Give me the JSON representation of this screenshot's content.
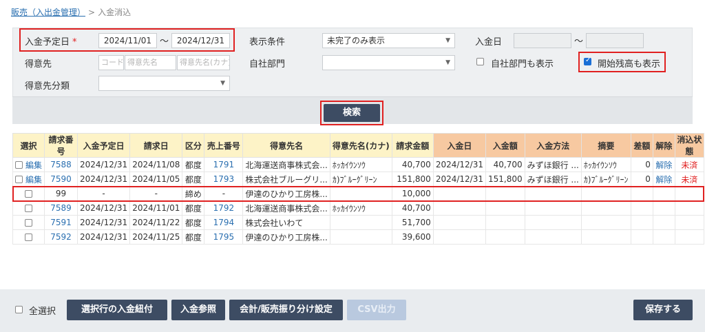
{
  "breadcrumb": {
    "parent": "販売（入出金管理）",
    "separator": ">",
    "current": "入金消込"
  },
  "search": {
    "due_date_label": "入金予定日",
    "required_mark": "*",
    "due_from": "2024/11/01",
    "due_to": "2024/12/31",
    "tilde": "〜",
    "display_cond_label": "表示条件",
    "display_cond_value": "未完了のみ表示",
    "payment_date_label": "入金日",
    "payment_from": "",
    "payment_to": "",
    "customer_label": "得意先",
    "customer_code_ph": "コード",
    "customer_name_ph": "得意先名",
    "customer_kana_ph": "得意先名(カナ)",
    "dept_label": "自社部門",
    "dept_value": "",
    "show_dept_label": "自社部門も表示",
    "show_opening_label": "開始残高も表示",
    "customer_class_label": "得意先分類",
    "customer_class_value": "",
    "search_button": "検索"
  },
  "table": {
    "headers": [
      "選択",
      "請求番号",
      "入金予定日",
      "請求日",
      "区分",
      "売上番号",
      "得意先名",
      "得意先名(カナ)",
      "請求金額",
      "入金日",
      "入金額",
      "入金方法",
      "摘要",
      "差額",
      "解除",
      "消込状態"
    ],
    "rows": [
      {
        "edit": "編集",
        "inv_no": "7588",
        "due": "2024/12/31",
        "inv_date": "2024/11/08",
        "kubun": "都度",
        "sales_no": "1791",
        "name": "北海運送商事株式会...",
        "kana": "ﾎｯｶｲｳﾝｿｳ",
        "amount": "40,700",
        "pay_date": "2024/12/31",
        "pay_amt": "40,700",
        "method": "みずほ銀行 ...",
        "memo": "ﾎｯｶｲｳﾝｿｳ",
        "diff": "0",
        "cancel": "解除",
        "status": "未済"
      },
      {
        "edit": "編集",
        "inv_no": "7590",
        "due": "2024/12/31",
        "inv_date": "2024/11/05",
        "kubun": "都度",
        "sales_no": "1793",
        "name": "株式会社ブルーグリ...",
        "kana": "ｶ)ﾌﾞﾙｰｸﾞﾘｰﾝ",
        "amount": "151,800",
        "pay_date": "2024/12/31",
        "pay_amt": "151,800",
        "method": "みずほ銀行 ...",
        "memo": "ｶ)ﾌﾞﾙｰｸﾞﾘｰﾝ",
        "diff": "0",
        "cancel": "解除",
        "status": "未済"
      },
      {
        "edit": "",
        "inv_no": "99",
        "due": "-",
        "inv_date": "-",
        "kubun": "締め",
        "sales_no": "-",
        "name": "伊達のひかり工房株...",
        "kana": "",
        "amount": "10,000",
        "pay_date": "",
        "pay_amt": "",
        "method": "",
        "memo": "",
        "diff": "",
        "cancel": "",
        "status": ""
      },
      {
        "edit": "",
        "inv_no": "7589",
        "due": "2024/12/31",
        "inv_date": "2024/11/01",
        "kubun": "都度",
        "sales_no": "1792",
        "name": "北海運送商事株式会...",
        "kana": "ﾎｯｶｲｳﾝｿｳ",
        "amount": "40,700",
        "pay_date": "",
        "pay_amt": "",
        "method": "",
        "memo": "",
        "diff": "",
        "cancel": "",
        "status": ""
      },
      {
        "edit": "",
        "inv_no": "7591",
        "due": "2024/12/31",
        "inv_date": "2024/11/22",
        "kubun": "都度",
        "sales_no": "1794",
        "name": "株式会社いわて",
        "kana": "",
        "amount": "51,700",
        "pay_date": "",
        "pay_amt": "",
        "method": "",
        "memo": "",
        "diff": "",
        "cancel": "",
        "status": ""
      },
      {
        "edit": "",
        "inv_no": "7592",
        "due": "2024/12/31",
        "inv_date": "2024/11/25",
        "kubun": "都度",
        "sales_no": "1795",
        "name": "伊達のひかり工房株...",
        "kana": "",
        "amount": "39,600",
        "pay_date": "",
        "pay_amt": "",
        "method": "",
        "memo": "",
        "diff": "",
        "cancel": "",
        "status": ""
      }
    ]
  },
  "footer": {
    "select_all": "全選択",
    "btn_link_payment": "選択行の入金紐付",
    "btn_payment_ref": "入金参照",
    "btn_allocation": "会計/販売振り分け設定",
    "btn_csv": "CSV出力",
    "btn_save": "保存する"
  },
  "colors": {
    "accent": "#3d4c63",
    "link": "#2a6fb0",
    "highlight": "#e02020",
    "header_yellow": "#fdf3c7",
    "header_orange": "#f7c9a1"
  }
}
